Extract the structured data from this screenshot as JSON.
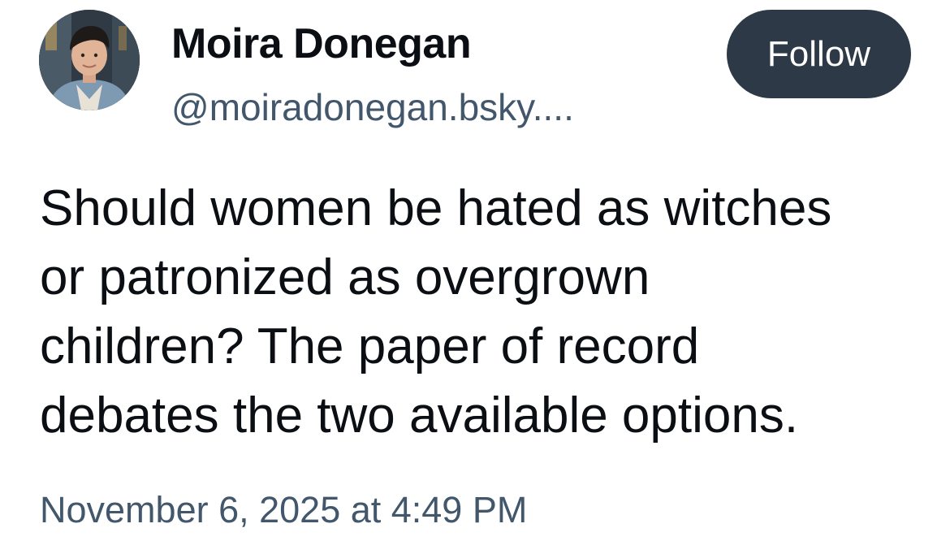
{
  "author": {
    "display_name": "Moira Donegan",
    "handle": "@moiradonegan.bsky....",
    "avatar_icon": "avatar-photo"
  },
  "actions": {
    "follow_label": "Follow"
  },
  "post": {
    "text": "Should women be hated as witches\nor patronized as overgrown\nchildren? The paper of record\ndebates the two available options.",
    "timestamp": "November 6, 2025 at 4:49 PM"
  },
  "colors": {
    "background": "#ffffff",
    "text": "#0b0f14",
    "muted": "#42576c",
    "follow_button": "#2d3947"
  }
}
